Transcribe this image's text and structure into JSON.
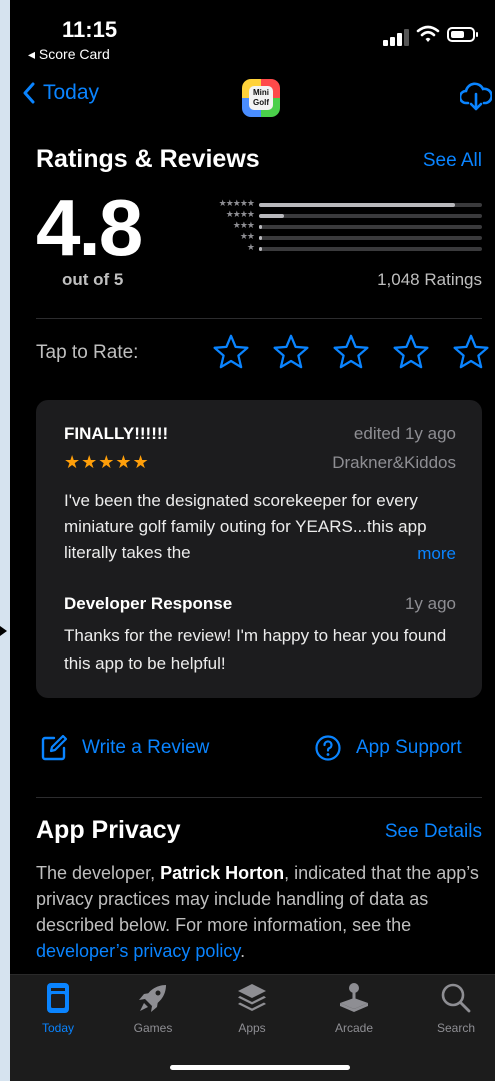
{
  "status_bar": {
    "time": "11:15",
    "back_app": "◂ Score Card"
  },
  "nav": {
    "back_label": "Today",
    "app_icon_text": "Mini Golf"
  },
  "ratings": {
    "title": "Ratings & Reviews",
    "see_all": "See All",
    "score": "4.8",
    "out_of": "out of 5",
    "count": "1,048 Ratings",
    "distribution": [
      {
        "stars": "★★★★★",
        "fraction": 0.88
      },
      {
        "stars": "★★★★",
        "fraction": 0.11
      },
      {
        "stars": "★★★",
        "fraction": 0.01
      },
      {
        "stars": "★★",
        "fraction": 0.005
      },
      {
        "stars": "★",
        "fraction": 0.005
      }
    ],
    "tap_to_rate": "Tap to Rate:"
  },
  "review": {
    "title": "FINALLY!!!!!!",
    "date": "edited 1y ago",
    "stars": "★★★★★",
    "author": "Drakner&Kiddos",
    "body": "I've been the designated scorekeeper for every miniature golf family outing for YEARS...this app literally takes the",
    "more": "more",
    "dev_label": "Developer Response",
    "dev_date": "1y ago",
    "dev_body": "Thanks for the review! I'm happy to hear you found this app to be helpful!"
  },
  "actions": {
    "write_review": "Write a Review",
    "app_support": "App Support"
  },
  "privacy": {
    "title": "App Privacy",
    "see_details": "See Details",
    "text_1": "The developer, ",
    "developer": "Patrick Horton",
    "text_2": ", indicated that the app’s privacy practices may include handling of data as described below. For more information, see the ",
    "policy_link": "developer’s privacy policy",
    "text_3": "."
  },
  "tabs": [
    {
      "label": "Today",
      "icon": "today-icon",
      "active": true
    },
    {
      "label": "Games",
      "icon": "rocket-icon",
      "active": false
    },
    {
      "label": "Apps",
      "icon": "apps-stack-icon",
      "active": false
    },
    {
      "label": "Arcade",
      "icon": "joystick-icon",
      "active": false
    },
    {
      "label": "Search",
      "icon": "search-icon",
      "active": false
    }
  ],
  "colors": {
    "accent": "#0a84ff",
    "star_orange": "#ff9f0a",
    "background": "#000000",
    "card": "#1c1c1e"
  }
}
